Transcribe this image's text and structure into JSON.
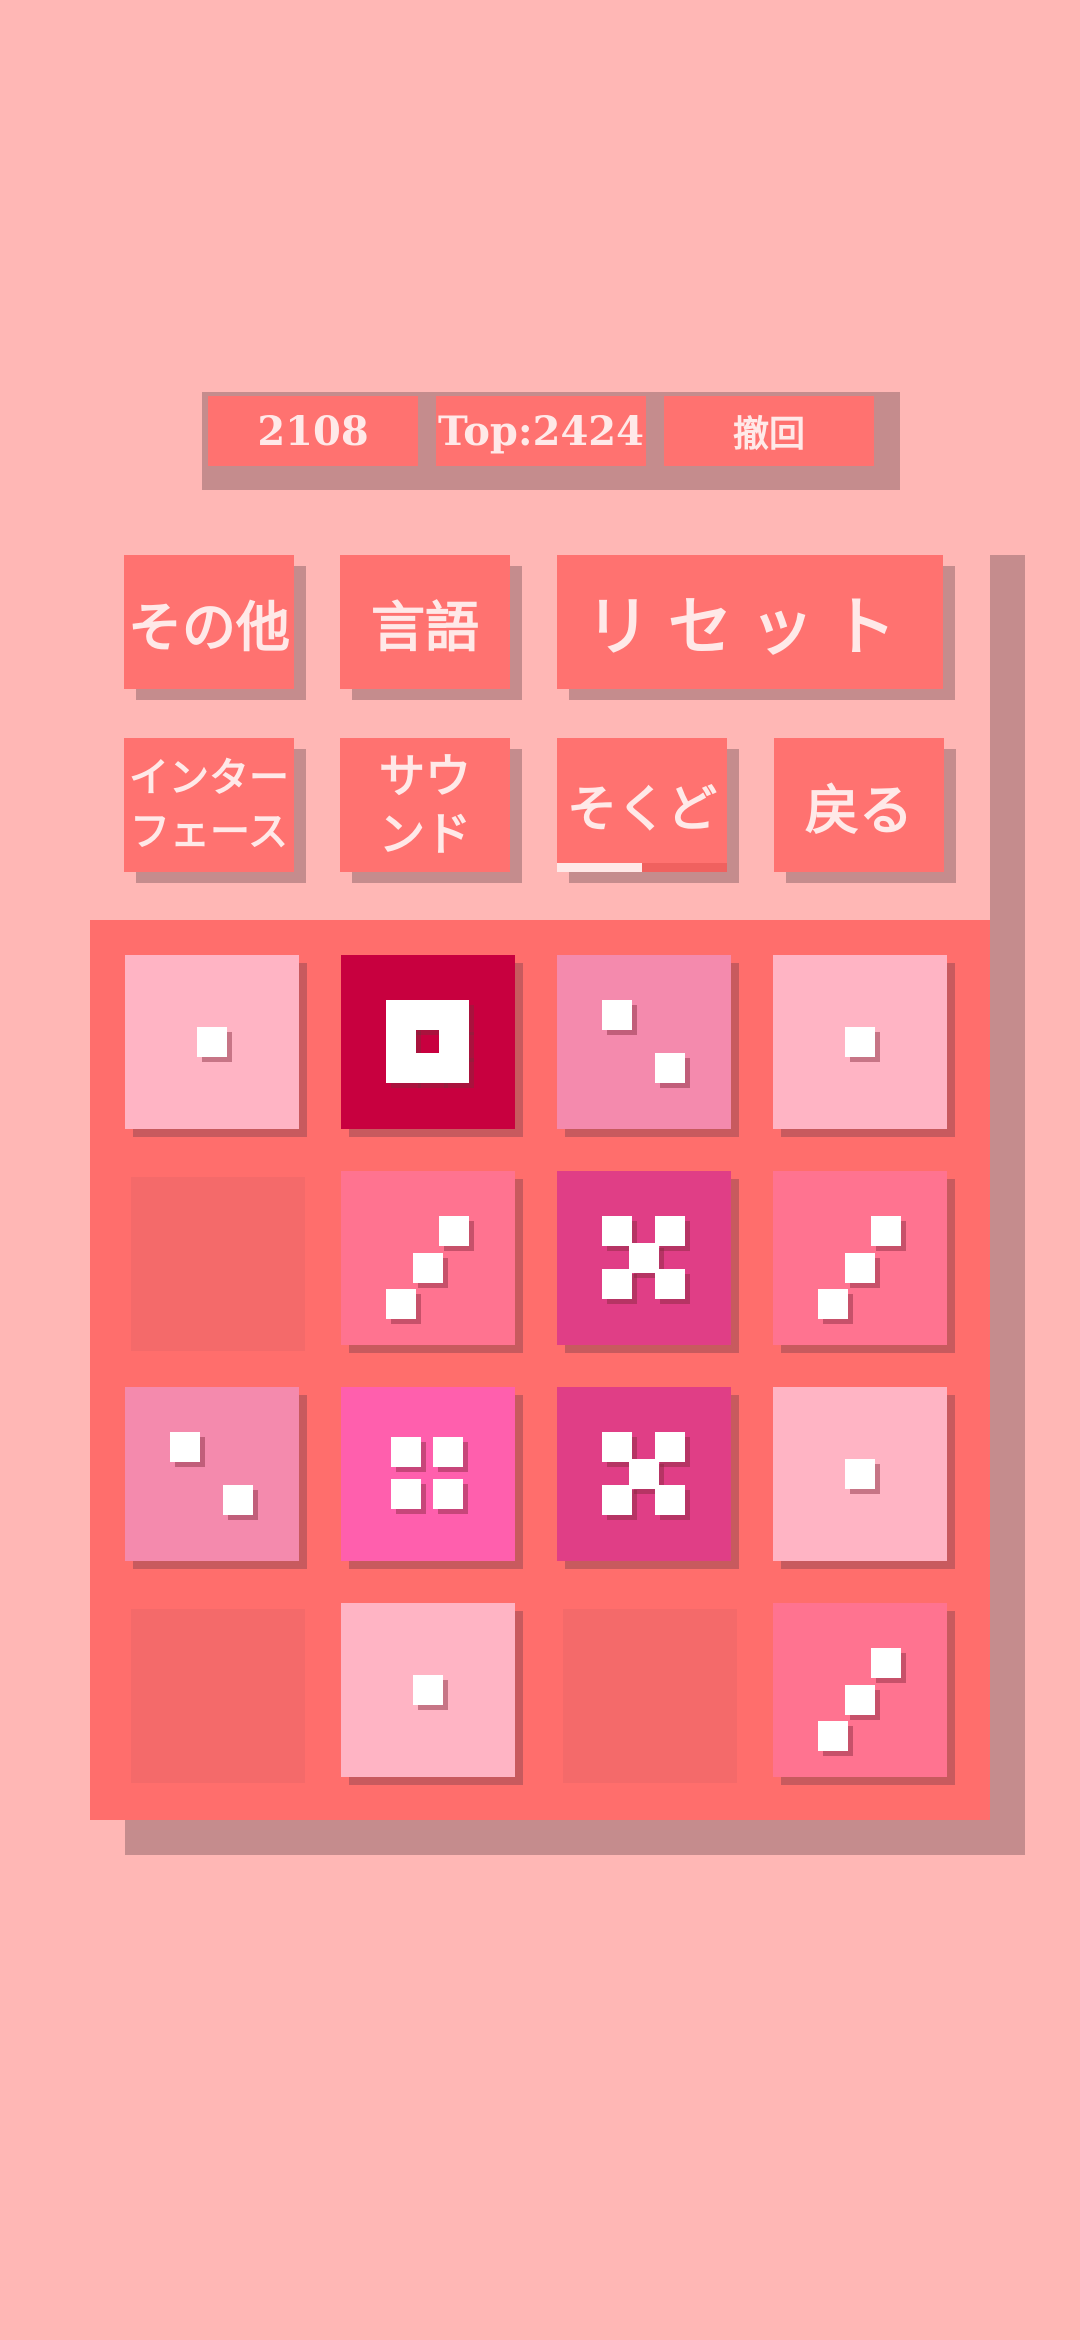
{
  "scoreboard": {
    "score": "2108",
    "top": "Top:2424",
    "undo_label": "撤回"
  },
  "menu": {
    "other_label": "その他",
    "language_label": "言語",
    "reset_label": "リセット",
    "interface_label_line1": "インター",
    "interface_label_line2": "フェース",
    "sound_label_line1": "サウ",
    "sound_label_line2": "ンド",
    "speed_label": "そくど",
    "back_label": "戻る",
    "speed_level": 0.5
  },
  "board": {
    "rows": 4,
    "cols": 4,
    "tiles": [
      [
        {
          "pips": 1,
          "color": "#ffb4c4"
        },
        {
          "pips": 8,
          "color": "#c8003f"
        },
        {
          "pips": 2,
          "color": "#f48aad"
        },
        {
          "pips": 1,
          "color": "#ffb4c4"
        }
      ],
      [
        {
          "pips": 0,
          "color": ""
        },
        {
          "pips": 3,
          "color": "#ff7390"
        },
        {
          "pips": 5,
          "color": "#e03e86"
        },
        {
          "pips": 3,
          "color": "#ff7390"
        }
      ],
      [
        {
          "pips": 2,
          "color": "#f48aad"
        },
        {
          "pips": 4,
          "color": "#ff5fad"
        },
        {
          "pips": 5,
          "color": "#e03e86"
        },
        {
          "pips": 1,
          "color": "#ffb4c4"
        }
      ],
      [
        {
          "pips": 0,
          "color": ""
        },
        {
          "pips": 1,
          "color": "#ffb4c4"
        },
        {
          "pips": 0,
          "color": ""
        },
        {
          "pips": 3,
          "color": "#ff7390"
        }
      ]
    ]
  },
  "colors": {
    "background": "#ffb7b5",
    "button": "#ff7270",
    "button_text": "#ffe9e8",
    "shadow": "#c58c8d",
    "board": "#ff6e6c",
    "empty_cell": "#f46a6a"
  }
}
